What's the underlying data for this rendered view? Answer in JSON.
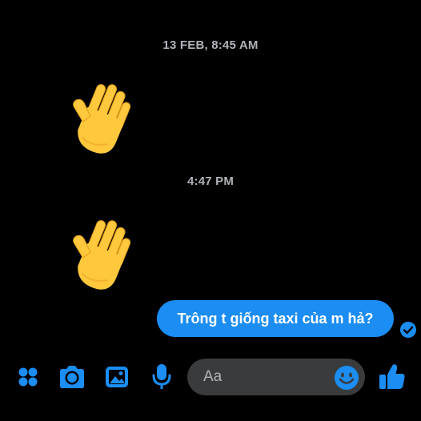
{
  "conversation": {
    "timestamps": [
      "13 FEB, 8:45 AM",
      "4:47 PM"
    ],
    "messages": [
      {
        "type": "emoji",
        "emoji": "raised-hand-emoji",
        "direction": "incoming"
      },
      {
        "type": "emoji",
        "emoji": "raised-hand-emoji",
        "direction": "incoming"
      },
      {
        "type": "text",
        "text": "Trông t giống taxi của m hả?",
        "direction": "outgoing",
        "status": "seen"
      }
    ]
  },
  "composer": {
    "placeholder": "Aa",
    "tools": [
      "apps-icon",
      "camera-icon",
      "gallery-icon",
      "microphone-icon"
    ],
    "emoji_icon": "smiley-icon",
    "send_icon": "thumbs-up-icon"
  },
  "colors": {
    "background": "#000000",
    "accent": "#1b8df3",
    "timestamp_text": "#b0b3b8",
    "input_background": "#3a3b3c",
    "emoji_yellow": "#ffc83d"
  }
}
